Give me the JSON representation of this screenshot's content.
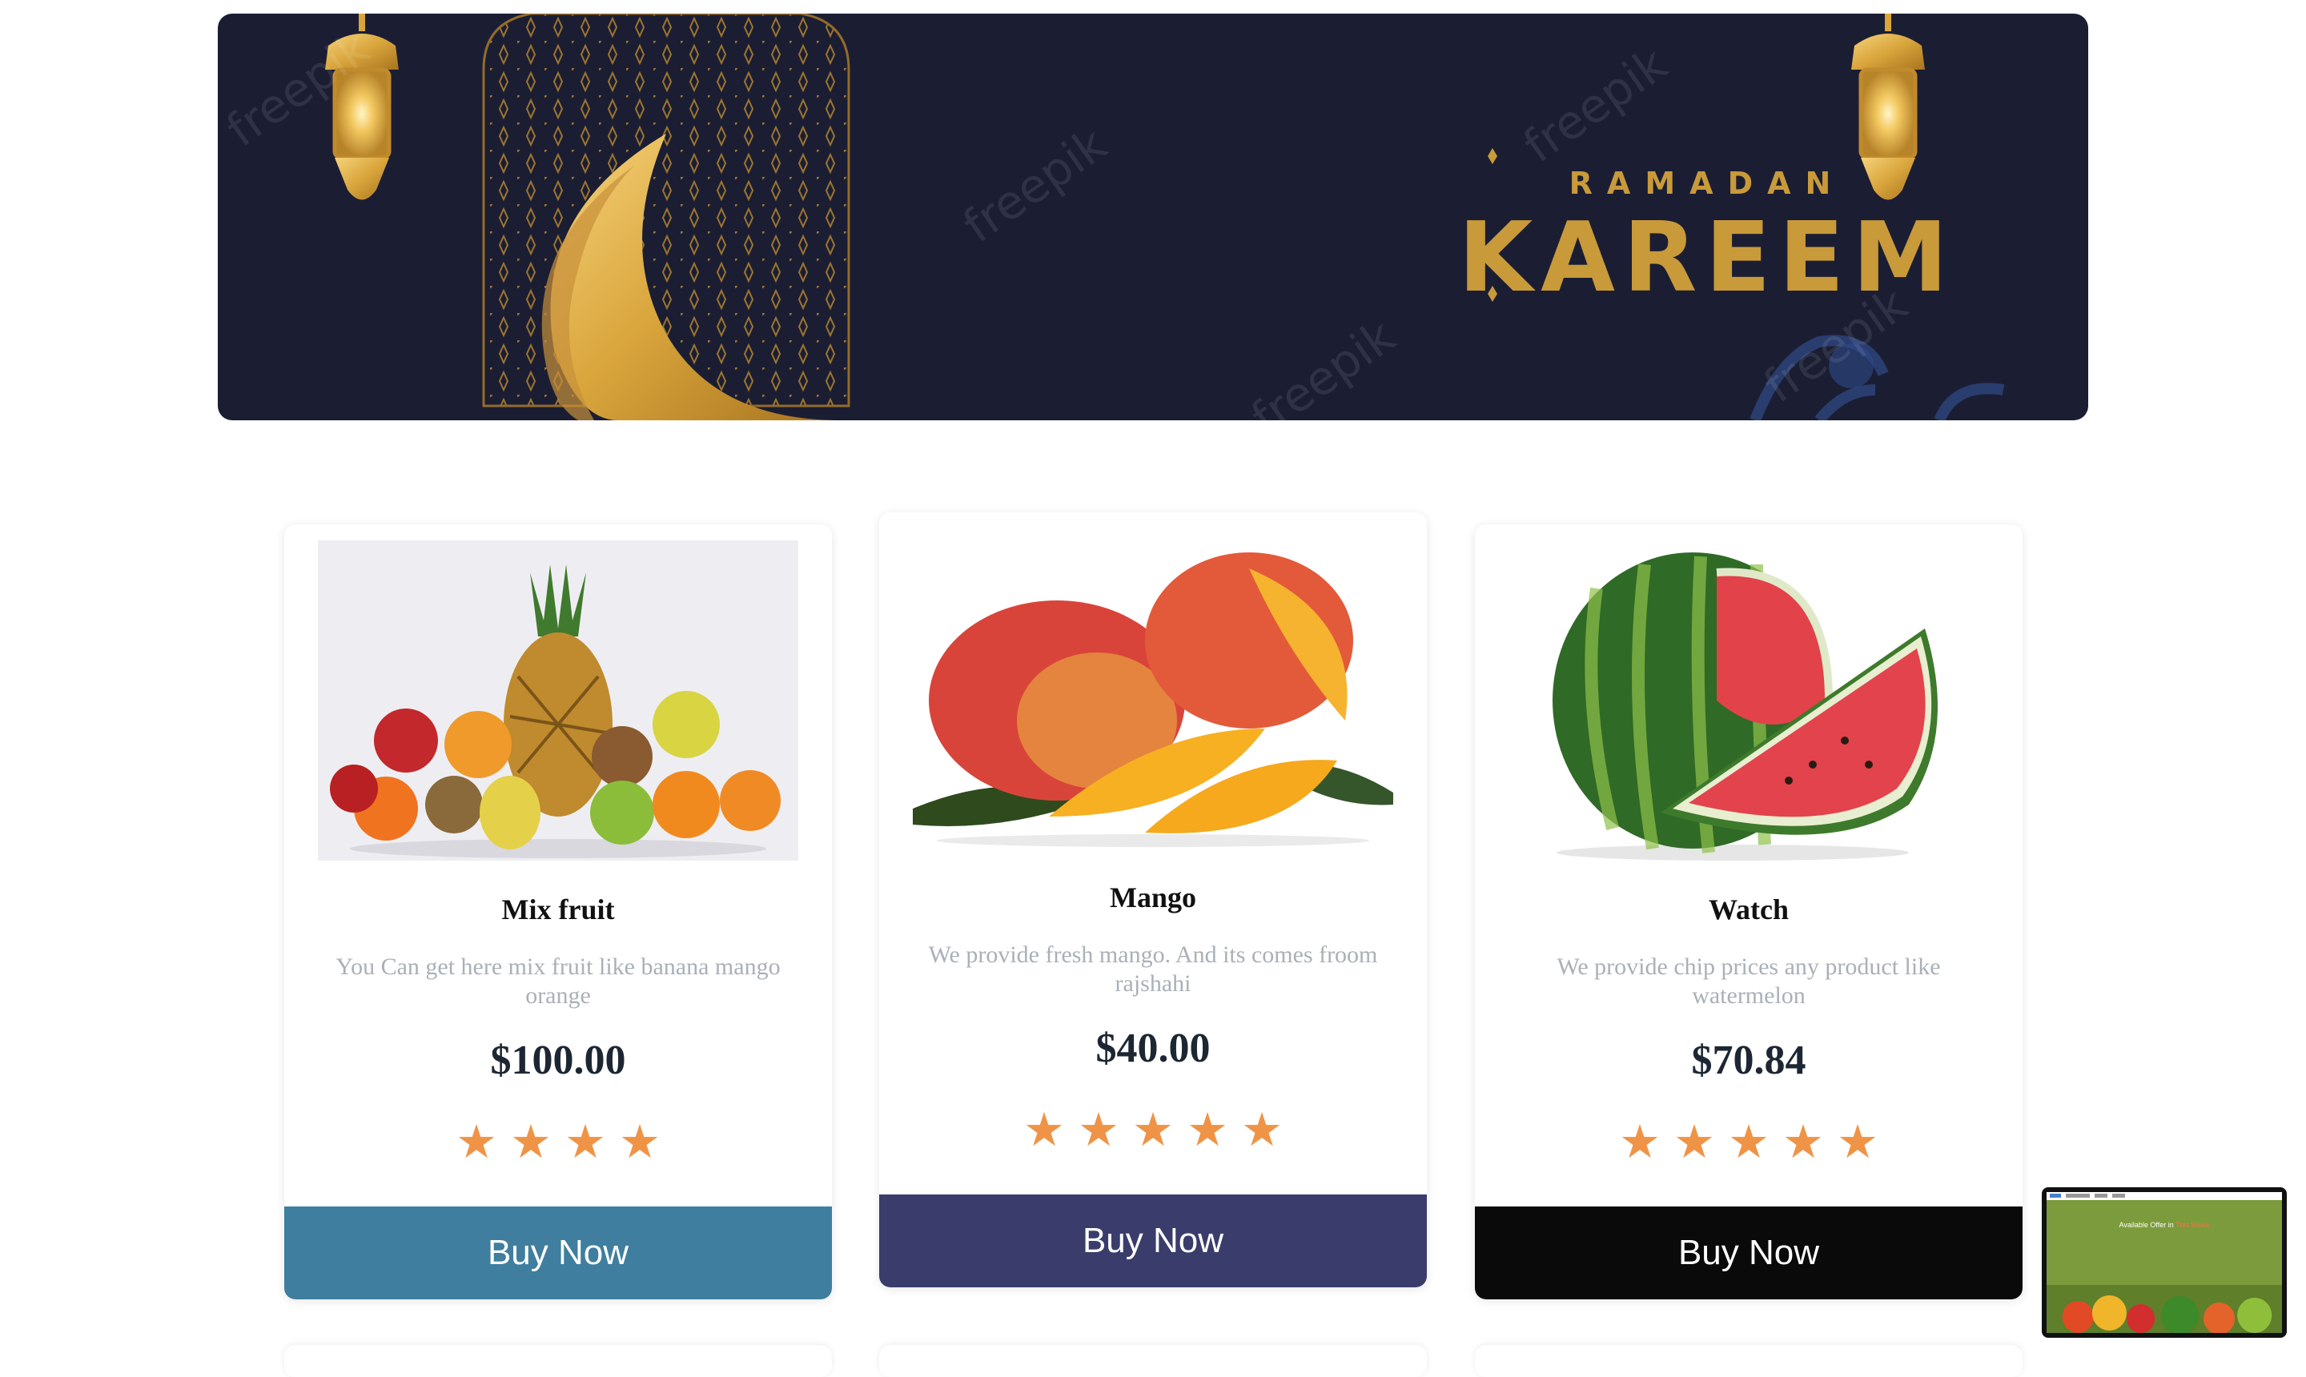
{
  "banner": {
    "subtitle": "RAMADAN",
    "title": "KAREEM",
    "watermark": "freepik"
  },
  "products": [
    {
      "title": "Mix fruit",
      "description": "You Can get here mix fruit like banana mango orange",
      "price": "$100.00",
      "rating": 4,
      "button_label": "Buy Now",
      "button_color": "#3f7e9e",
      "image": "mixed-fruit-image"
    },
    {
      "title": "Mango",
      "description": "We provide fresh mango. And its comes froom rajshahi",
      "price": "$40.00",
      "rating": 5,
      "button_label": "Buy Now",
      "button_color": "#3a3d6b",
      "image": "mango-image"
    },
    {
      "title": "Watch",
      "description": "We provide chip prices any product like watermelon",
      "price": "$70.84",
      "rating": 5,
      "button_label": "Buy Now",
      "button_color": "#0a0a0a",
      "image": "watermelon-image"
    }
  ],
  "star_icon": "star-icon",
  "star_color": "#ef9446",
  "preview": {
    "text": "Available Offer in",
    "highlight": "This Week"
  }
}
